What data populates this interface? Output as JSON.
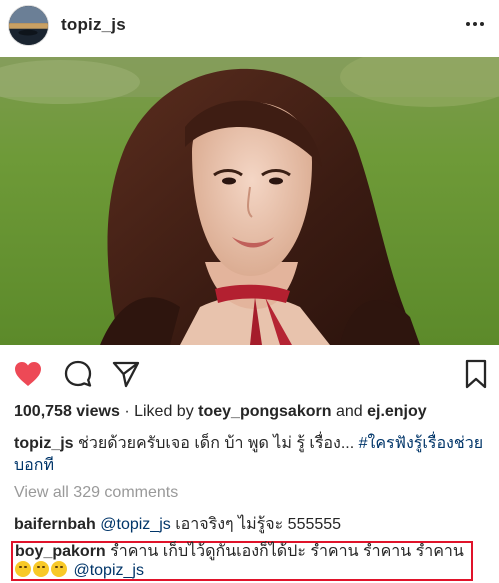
{
  "post_header": {
    "username": "topiz_js"
  },
  "actions": {
    "like_icon": "heart-filled-icon",
    "comment_icon": "comment-icon",
    "share_icon": "paper-plane-icon",
    "save_icon": "bookmark-icon",
    "like_color": "#ed4956"
  },
  "stats": {
    "views": "100,758 views",
    "liked_by_prefix": " · Liked by ",
    "liker_1": "toey_pongsakorn",
    "and_text": " and ",
    "liker_2": "ej.enjoy"
  },
  "caption": {
    "username": "topiz_js",
    "text": " ช่วยด้วยครับเจอ เด็ก บ้า พูด ไม่ รู้ เรื่อง... ",
    "hashtag": "#ใครฟังรู้เรื่องช่วยบอกที"
  },
  "comments": {
    "view_all": "View all 329 comments",
    "items": [
      {
        "username": "baifernbah",
        "mention": "@topiz_js",
        "text": " เอาจริงๆ ไม่รู้จะ 555555"
      },
      {
        "username": "boy_pakorn",
        "text": " รำคาน เก็บไว้ดูกันเองก็ได้ปะ รำคาน รำคาน รำคาน",
        "mention": "@topiz_js",
        "highlight_color": "#e0132a"
      }
    ]
  }
}
